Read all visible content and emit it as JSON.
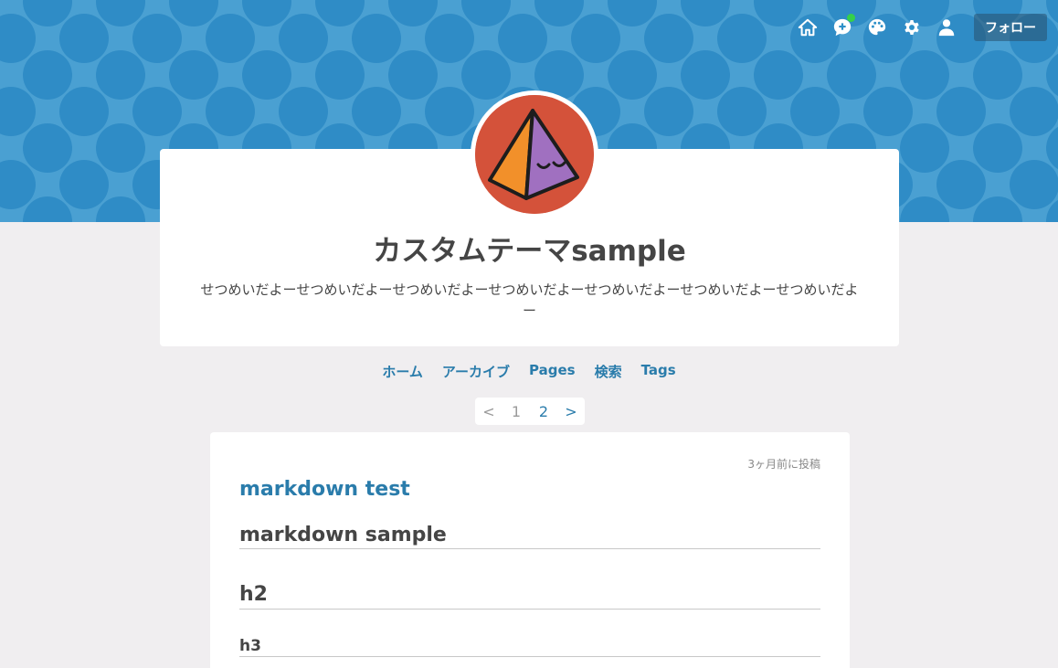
{
  "header": {
    "follow_label": "フォロー",
    "icons": [
      "home-icon",
      "add-comment-icon",
      "palette-icon",
      "gear-icon",
      "user-icon"
    ],
    "accent": "#2d90c8"
  },
  "profile": {
    "title": "カスタムテーマsample",
    "description": "せつめいだよーせつめいだよーせつめいだよーせつめいだよーせつめいだよーせつめいだよーせつめいだよー"
  },
  "nav": {
    "items": [
      "ホーム",
      "アーカイブ",
      "Pages",
      "検索",
      "Tags"
    ]
  },
  "pager": {
    "prev": "<",
    "pages": [
      "1",
      "2"
    ],
    "next": ">"
  },
  "article": {
    "date": "3ヶ月前に投稿",
    "title": "markdown test",
    "headings": [
      "markdown sample",
      "h2",
      "h3"
    ]
  }
}
